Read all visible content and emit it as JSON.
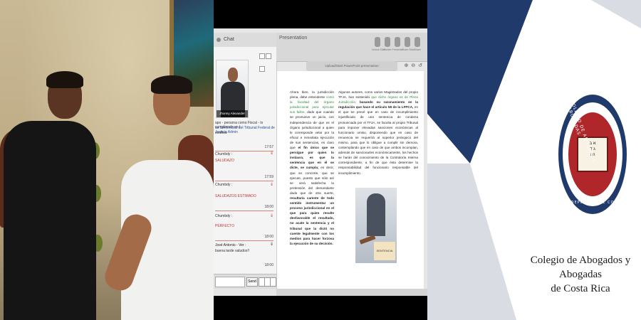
{
  "video_left": {
    "label": "participants video"
  },
  "conference": {
    "chat": {
      "title": "Chat",
      "presenter_name": "Jhonny Alexander López",
      "header_text": "apo - persona como Fiscal - lo cumpliendo en l",
      "header_text2": "as Sentencias del Tribunal Federal de Justicia Admin",
      "header_text3": "strativa",
      "messages": [
        {
          "time": "17:57",
          "name": "Chumbdy :",
          "body": "SALUDAZO"
        },
        {
          "time": "17:59",
          "name": "Chumbdy :",
          "body": "SALUDAZOS ESTIMADO"
        },
        {
          "time": "18:00",
          "name": "Chumbdy :",
          "body": "PERFECTO"
        },
        {
          "time": "18:00",
          "name": "José Antonio - Ver :",
          "body": "buena tarde saludos!!"
        }
      ],
      "last_time": "18:00",
      "send_label": "Send"
    },
    "presentation": {
      "title": "Presentation",
      "tools": [
        "Unlock Slide",
        "Pointer",
        "Presenter",
        "Share Slide",
        "Share"
      ],
      "upload_label": "Upload/Start PowerPoint presentation",
      "zoom_icons": "⊕ ⊖ ↺",
      "col1": {
        "p1": "Ahora bien, la jurisdicción plena, debe entenderse",
        "p1_green": "como la facultad del órgano jurisdiccional para ejecutar sus fallos,",
        "p1_rest": "dado que cuando se promueve un juicio, con independencia de que es el órgano jurisdiccional a quien le corresponde velar por la eficaz e inmediata ejecución de sus sentencias, es claro que",
        "p1_bold": "el fin único que se persigue por quien lo instaura, es que la sentencia que en él se dicte, se cumpla;",
        "p1_rest2": "es decir, que se concrete, que se ejecute, puesto que sólo así se verá satisfecha la pretensión del demandante dado que de otra suerte,",
        "p1_bold2": "resultaría carente de todo sentido instrumentar un proceso jurisdiccional en el que para quien resulte desfavorable el resultado, no acate la sentencia y el tribunal que la dictó no cuente legalmente con los medios para hacer forzosa la ejecución de su decisión."
      },
      "col2": {
        "p1": "Algunos autores, como varios Magistrados del propio TFJA, han sostenido",
        "p1_green": "que dicho órgano es de Plena Jurisdicción,",
        "p1_bold": "basando su razonamiento en la regulación que hace el artículo 58 de la LFPCA,",
        "p1_rest": "en el que se prevé que en caso de incumplimiento injustificado de una sentencia de condena pronunciada por el TFJA, se faculta al propio Tribunal para imponer elevadas sanciones económicas al funcionario omiso, disponiendo que en caso de renuencia se requerirá al superior jerárquico del mismo, para que lo obligue a cumplir sin demora, contemplando que en caso de que ambos incumplan, además de sancionarles económicamente, los hechos se harán del conocimiento de la Contraloría Interna correspondiente, a fin de que ésta determine la responsabilidad del funcionario responsable del incumplimiento."
      },
      "image_caption": "SENTENCIA"
    }
  },
  "logo_panel": {
    "org_name_line1": "Colegio de Abogados y Abogadas",
    "org_name_line2": "de Costa Rica",
    "seal_top": "COLEGIO DE ABOGADOS Y ABOGADAS",
    "seal_bottom": "REPÚBLICA DE COSTA RICA",
    "colors": {
      "navy": "#1f3a6b",
      "red": "#b0272b",
      "gray": "#d9dde3"
    }
  }
}
